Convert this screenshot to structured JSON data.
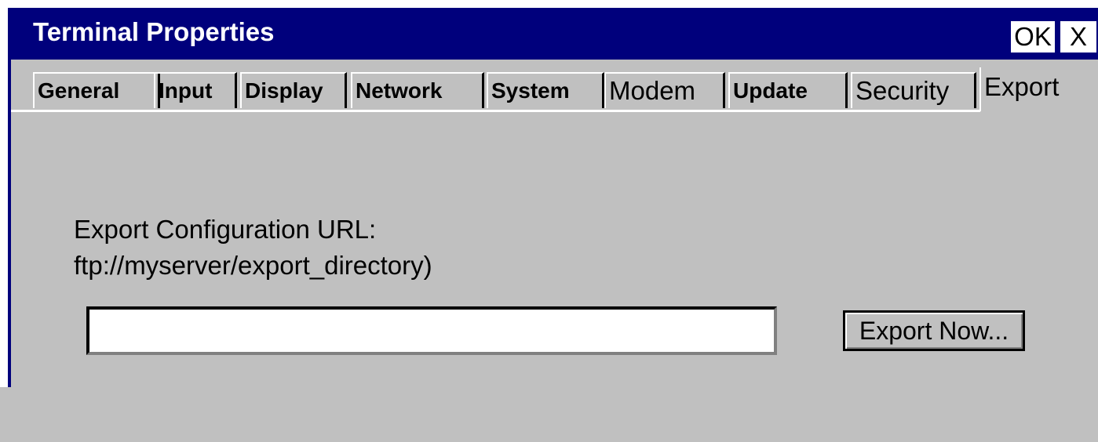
{
  "window": {
    "title": "Terminal Properties",
    "ok_label": "OK",
    "close_label": "X"
  },
  "tabs": [
    {
      "label": "General",
      "active": false
    },
    {
      "label": "Input",
      "active": false
    },
    {
      "label": "Display",
      "active": false
    },
    {
      "label": "Network",
      "active": false
    },
    {
      "label": "System",
      "active": false
    },
    {
      "label": "Modem",
      "active": false
    },
    {
      "label": "Update",
      "active": false
    },
    {
      "label": "Security",
      "active": false
    },
    {
      "label": "Export",
      "active": true
    }
  ],
  "export_panel": {
    "label_line1": "Export Configuration URL:",
    "label_line2": "ftp://myserver/export_directory)",
    "url_value": "",
    "export_button_label": "Export Now..."
  },
  "colors": {
    "titlebar": "#00007c",
    "face": "#c0c0c0"
  }
}
